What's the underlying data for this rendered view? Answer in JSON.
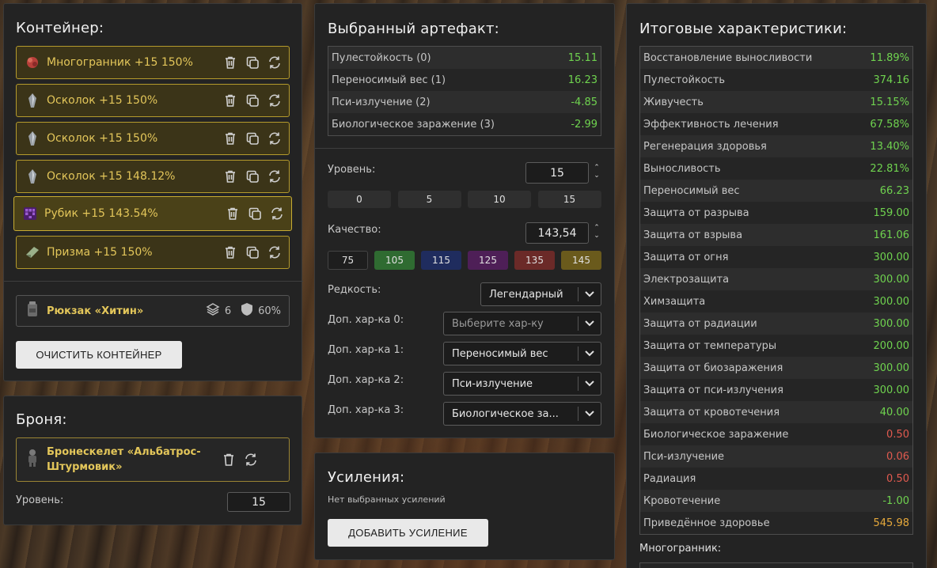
{
  "container": {
    "title": "Контейнер:",
    "artifacts": [
      {
        "name": "Многогранник +15 150%",
        "icon": "polyhedron-icon"
      },
      {
        "name": "Осколок +15 150%",
        "icon": "shard-icon"
      },
      {
        "name": "Осколок +15 150%",
        "icon": "shard-icon"
      },
      {
        "name": "Осколок +15 148.12%",
        "icon": "shard-icon"
      },
      {
        "name": "Рубик +15 143.54%",
        "icon": "rubik-icon",
        "selected": true
      },
      {
        "name": "Призма +15 150%",
        "icon": "prism-icon"
      }
    ],
    "backpack": {
      "name": "Рюкзак «Хитин»",
      "slots": "6",
      "protection": "60%"
    },
    "clear_button": "ОЧИСТИТЬ КОНТЕЙНЕР"
  },
  "armor": {
    "title": "Броня:",
    "item_name": "Бронескелет «Альбатрос-Штурмовик»",
    "level_label": "Уровень:",
    "level_value": "15"
  },
  "selected": {
    "title": "Выбранный артефакт:",
    "stats": [
      {
        "label": "Пулестойкость (0)",
        "value": "15.11",
        "color": "green"
      },
      {
        "label": "Переносимый вес (1)",
        "value": "16.23",
        "color": "green"
      },
      {
        "label": "Пси-излучение (2)",
        "value": "-4.85",
        "color": "green"
      },
      {
        "label": "Биологическое заражение (3)",
        "value": "-2.99",
        "color": "green"
      }
    ],
    "level_label": "Уровень:",
    "level_value": "15",
    "level_presets": [
      "0",
      "5",
      "10",
      "15"
    ],
    "quality_label": "Качество:",
    "quality_value": "143,54",
    "quality_presets": [
      {
        "label": "75",
        "color": "#1e1e1e"
      },
      {
        "label": "105",
        "color": "#2f6b31"
      },
      {
        "label": "115",
        "color": "#1f2c5e"
      },
      {
        "label": "125",
        "color": "#4e1f57"
      },
      {
        "label": "135",
        "color": "#6b2a28"
      },
      {
        "label": "145",
        "color": "#6a5a1c"
      }
    ],
    "rarity_label": "Редкость:",
    "rarity_value": "Легендарный",
    "extra": [
      {
        "label": "Доп. хар-ка 0:",
        "value": "Выберите хар-ку",
        "placeholder": true
      },
      {
        "label": "Доп. хар-ка 1:",
        "value": "Переносимый вес"
      },
      {
        "label": "Доп. хар-ка 2:",
        "value": "Пси-излучение"
      },
      {
        "label": "Доп. хар-ка 3:",
        "value": "Биологическое за..."
      }
    ]
  },
  "boost": {
    "title": "Усиления:",
    "empty_text": "Нет выбранных усилений",
    "add_button": "ДОБАВИТЬ УСИЛЕНИЕ"
  },
  "totals": {
    "title": "Итоговые характеристики:",
    "stats": [
      {
        "label": "Восстановление выносливости",
        "value": "11.89%",
        "color": "green"
      },
      {
        "label": "Пулестойкость",
        "value": "374.16",
        "color": "green"
      },
      {
        "label": "Живучесть",
        "value": "15.15%",
        "color": "green"
      },
      {
        "label": "Эффективность лечения",
        "value": "67.58%",
        "color": "green"
      },
      {
        "label": "Регенерация здоровья",
        "value": "13.40%",
        "color": "green"
      },
      {
        "label": "Выносливость",
        "value": "22.81%",
        "color": "green"
      },
      {
        "label": "Переносимый вес",
        "value": "66.23",
        "color": "green"
      },
      {
        "label": "Защита от разрыва",
        "value": "159.00",
        "color": "green"
      },
      {
        "label": "Защита от взрыва",
        "value": "161.06",
        "color": "green"
      },
      {
        "label": "Защита от огня",
        "value": "300.00",
        "color": "green"
      },
      {
        "label": "Электрозащита",
        "value": "300.00",
        "color": "green"
      },
      {
        "label": "Химзащита",
        "value": "300.00",
        "color": "green"
      },
      {
        "label": "Защита от радиации",
        "value": "300.00",
        "color": "green"
      },
      {
        "label": "Защита от температуры",
        "value": "200.00",
        "color": "green"
      },
      {
        "label": "Защита от биозаражения",
        "value": "300.00",
        "color": "green"
      },
      {
        "label": "Защита от пси-излучения",
        "value": "300.00",
        "color": "green"
      },
      {
        "label": "Защита от кровотечения",
        "value": "40.00",
        "color": "green"
      },
      {
        "label": "Биологическое заражение",
        "value": "0.50",
        "color": "red"
      },
      {
        "label": "Пси-излучение",
        "value": "0.06",
        "color": "red"
      },
      {
        "label": "Радиация",
        "value": "0.50",
        "color": "red"
      },
      {
        "label": "Кровотечение",
        "value": "-1.00",
        "color": "green"
      },
      {
        "label": "Приведённое здоровье",
        "value": "545.98",
        "color": "orange"
      }
    ],
    "subsection": "Многогранник:"
  }
}
